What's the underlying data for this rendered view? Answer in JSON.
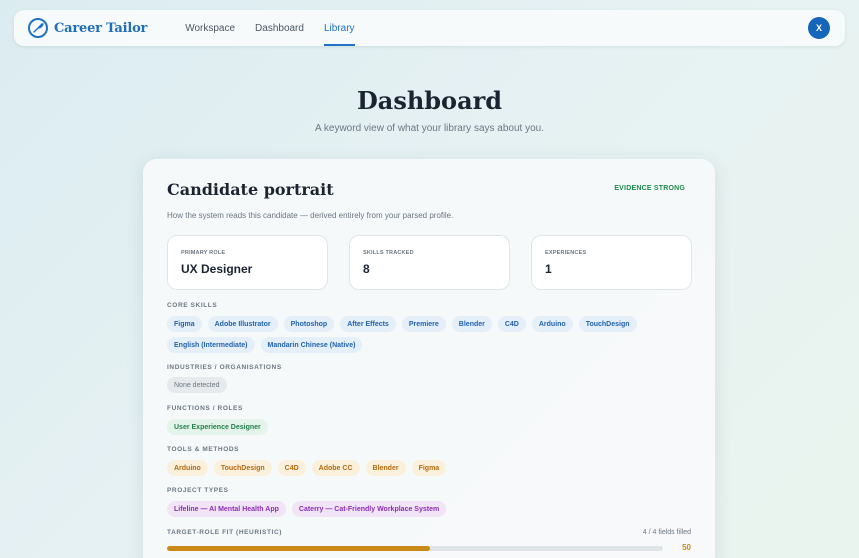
{
  "app": {
    "name": "Career Tailor"
  },
  "nav": {
    "items": [
      {
        "label": "Workspace",
        "active": false
      },
      {
        "label": "Dashboard",
        "active": false
      },
      {
        "label": "Library",
        "active": true
      }
    ]
  },
  "user": {
    "initial": "X"
  },
  "page": {
    "title": "Dashboard",
    "subtitle": "A keyword view of what your library says about you."
  },
  "portrait": {
    "title": "Candidate portrait",
    "evidence": "EVIDENCE STRONG",
    "description": "How the system reads this candidate — derived entirely from your parsed profile.",
    "stats": [
      {
        "label": "PRIMARY ROLE",
        "value": "UX Designer"
      },
      {
        "label": "SKILLS TRACKED",
        "value": "8"
      },
      {
        "label": "EXPERIENCES",
        "value": "1"
      }
    ],
    "core_skills": {
      "label": "CORE SKILLS",
      "items": [
        "Figma",
        "Adobe Illustrator",
        "Photoshop",
        "After Effects",
        "Premiere",
        "Blender",
        "C4D",
        "Arduino",
        "TouchDesign",
        "English (Intermediate)",
        "Mandarin Chinese (Native)"
      ]
    },
    "industries": {
      "label": "INDUSTRIES / ORGANISATIONS",
      "items": [
        "None detected"
      ]
    },
    "functions": {
      "label": "FUNCTIONS / ROLES",
      "items": [
        "User Experience Designer"
      ]
    },
    "tools": {
      "label": "TOOLS & METHODS",
      "items": [
        "Arduino",
        "TouchDesign",
        "C4D",
        "Adobe CC",
        "Blender",
        "Figma"
      ]
    },
    "projects": {
      "label": "PROJECT TYPES",
      "items": [
        "Lifeline — AI Mental Health App",
        "Caterry — Cat-Friendly Workplace System"
      ]
    },
    "fit": {
      "label": "TARGET-ROLE FIT (HEURISTIC)",
      "count": "4 / 4 fields filled",
      "score": "50",
      "progress": 0.53
    }
  },
  "colors": {
    "accent": "#1f73c4",
    "evidence": "#1e8a4c",
    "fit": "#c98a17"
  }
}
